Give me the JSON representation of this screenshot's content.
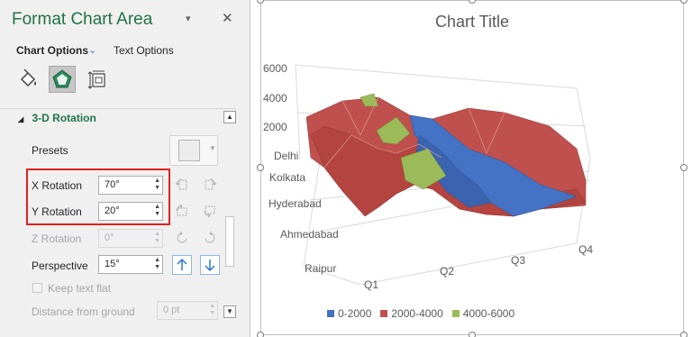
{
  "pane": {
    "title": "Format Chart Area",
    "dropdown_icon": "▾",
    "close_icon": "✕",
    "tabs": {
      "chart_options": "Chart Options",
      "text_options": "Text Options"
    },
    "icons": [
      "fill-line-icon",
      "effects-icon",
      "size-properties-icon"
    ],
    "section_title": "3-D Rotation",
    "section_collapse_icon": "◢",
    "presets_label": "Presets",
    "x_rotation": {
      "label": "X Rotation",
      "value": "70°"
    },
    "y_rotation": {
      "label": "Y Rotation",
      "value": "20°"
    },
    "z_rotation": {
      "label": "Z Rotation",
      "value": "0°"
    },
    "perspective": {
      "label": "Perspective",
      "value": "15°"
    },
    "keep_text_flat": "Keep text flat",
    "distance_from_ground": {
      "label": "Distance from ground",
      "value": "0 pt"
    },
    "accent_color": "#217346",
    "highlight_color": "#e02020"
  },
  "chart": {
    "title": "Chart Title",
    "z_ticks": [
      "6000",
      "4000",
      "2000"
    ],
    "y_ticks": [
      "Delhi",
      "Kolkata",
      "Hyderabad",
      "Ahmedabad",
      "Raipur"
    ],
    "x_ticks": [
      "Q1",
      "Q2",
      "Q3",
      "Q4"
    ],
    "legend": [
      {
        "label": "0-2000",
        "color": "#4472c4"
      },
      {
        "label": "2000-4000",
        "color": "#c0504d"
      },
      {
        "label": "4000-6000",
        "color": "#9bbb59"
      }
    ]
  },
  "chart_data": {
    "type": "surface",
    "title": "Chart Title",
    "categories": [
      "Q1",
      "Q2",
      "Q3",
      "Q4"
    ],
    "depth_categories": [
      "Delhi",
      "Kolkata",
      "Hyderabad",
      "Ahmedabad",
      "Raipur"
    ],
    "z_axis_ticks": [
      2000,
      4000,
      6000
    ],
    "bands": [
      "0-2000",
      "2000-4000",
      "4000-6000"
    ]
  }
}
